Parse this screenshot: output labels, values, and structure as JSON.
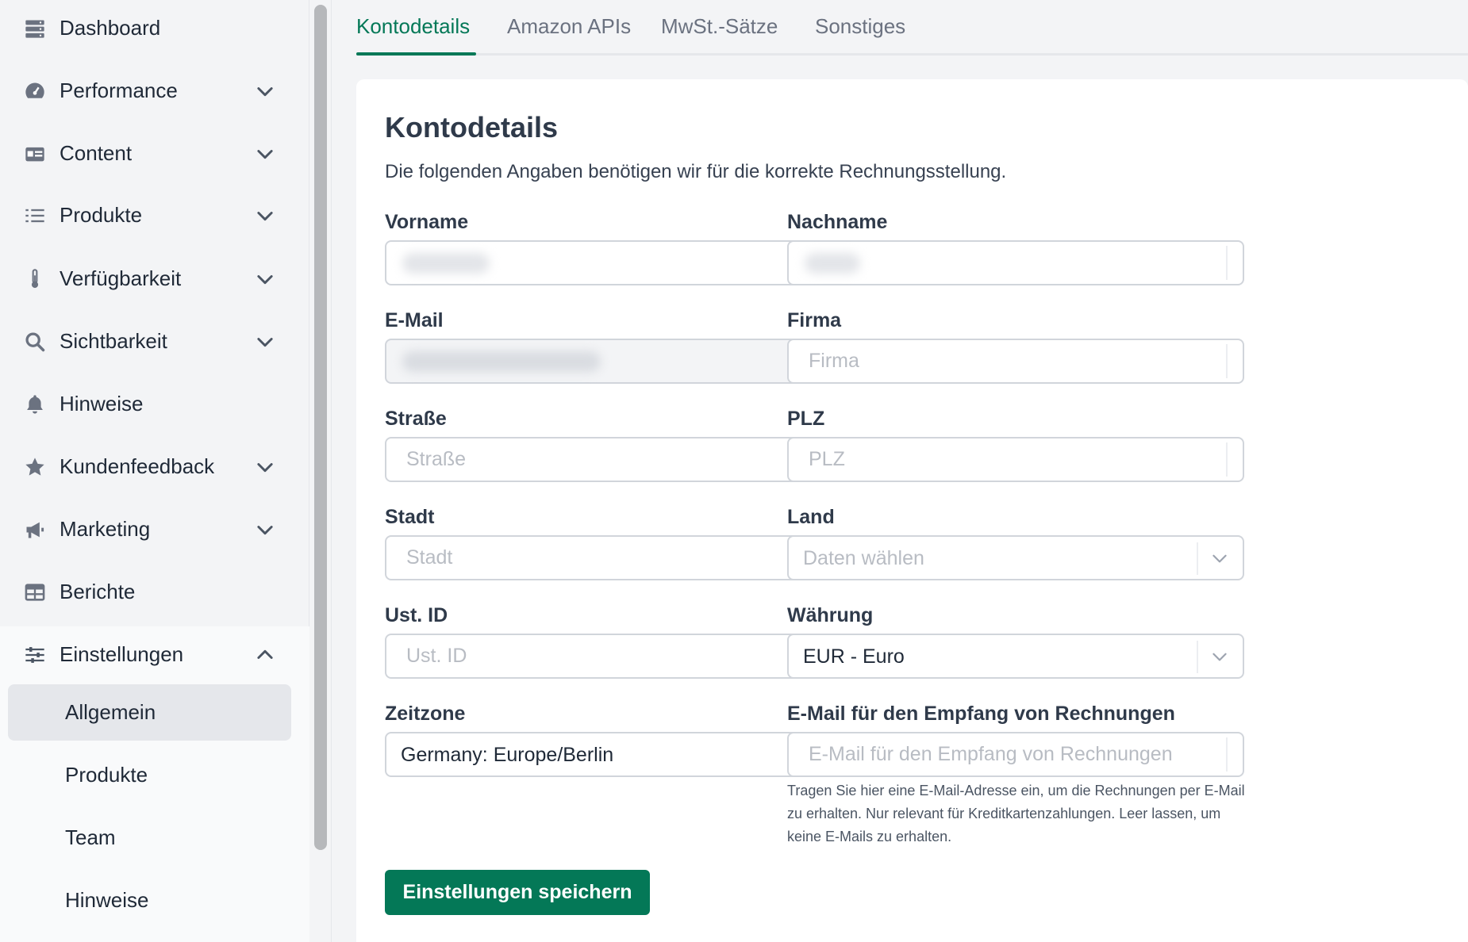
{
  "sidebar": {
    "items": [
      {
        "label": "Dashboard",
        "icon": "server-icon"
      },
      {
        "label": "Performance",
        "icon": "gauge-icon"
      },
      {
        "label": "Content",
        "icon": "id-card-icon"
      },
      {
        "label": "Produkte",
        "icon": "list-icon"
      },
      {
        "label": "Verfügbarkeit",
        "icon": "thermometer-icon"
      },
      {
        "label": "Sichtbarkeit",
        "icon": "search-icon"
      },
      {
        "label": "Hinweise",
        "icon": "bell-icon"
      },
      {
        "label": "Kundenfeedback",
        "icon": "star-icon"
      },
      {
        "label": "Marketing",
        "icon": "megaphone-icon"
      },
      {
        "label": "Berichte",
        "icon": "table-icon"
      },
      {
        "label": "Einstellungen",
        "icon": "sliders-icon"
      }
    ],
    "settings_subitems": [
      {
        "label": "Allgemein"
      },
      {
        "label": "Produkte"
      },
      {
        "label": "Team"
      },
      {
        "label": "Hinweise"
      }
    ]
  },
  "tabs": [
    {
      "label": "Kontodetails"
    },
    {
      "label": "Amazon APIs"
    },
    {
      "label": "MwSt.-Sätze"
    },
    {
      "label": "Sonstiges"
    }
  ],
  "form": {
    "title": "Kontodetails",
    "description": "Die folgenden Angaben benötigen wir für die korrekte Rechnungsstellung.",
    "vorname": {
      "label": "Vorname"
    },
    "nachname": {
      "label": "Nachname"
    },
    "email": {
      "label": "E-Mail"
    },
    "firma": {
      "label": "Firma",
      "placeholder": "Firma"
    },
    "strasse": {
      "label": "Straße",
      "placeholder": "Straße"
    },
    "plz": {
      "label": "PLZ",
      "placeholder": "PLZ"
    },
    "stadt": {
      "label": "Stadt",
      "placeholder": "Stadt"
    },
    "land": {
      "label": "Land",
      "value": "Daten wählen"
    },
    "ustid": {
      "label": "Ust. ID",
      "placeholder": "Ust. ID"
    },
    "waehrung": {
      "label": "Währung",
      "value": "EUR - Euro"
    },
    "zeitzone": {
      "label": "Zeitzone",
      "value": "Germany: Europe/Berlin"
    },
    "rechnungsemail": {
      "label": "E-Mail für den Empfang von Rechnungen",
      "placeholder": "E-Mail für den Empfang von Rechnungen",
      "hint": "Tragen Sie hier eine E-Mail-Adresse ein, um die Rechnungen per E-Mail zu erhalten. Nur relevant für Kreditkartenzahlungen. Leer lassen, um keine E-Mails zu erhalten."
    },
    "save_label": "Einstellungen speichern"
  },
  "colors": {
    "accent": "#047857",
    "text": "#1f2937",
    "sidebar_bg": "#f3f4f6"
  }
}
